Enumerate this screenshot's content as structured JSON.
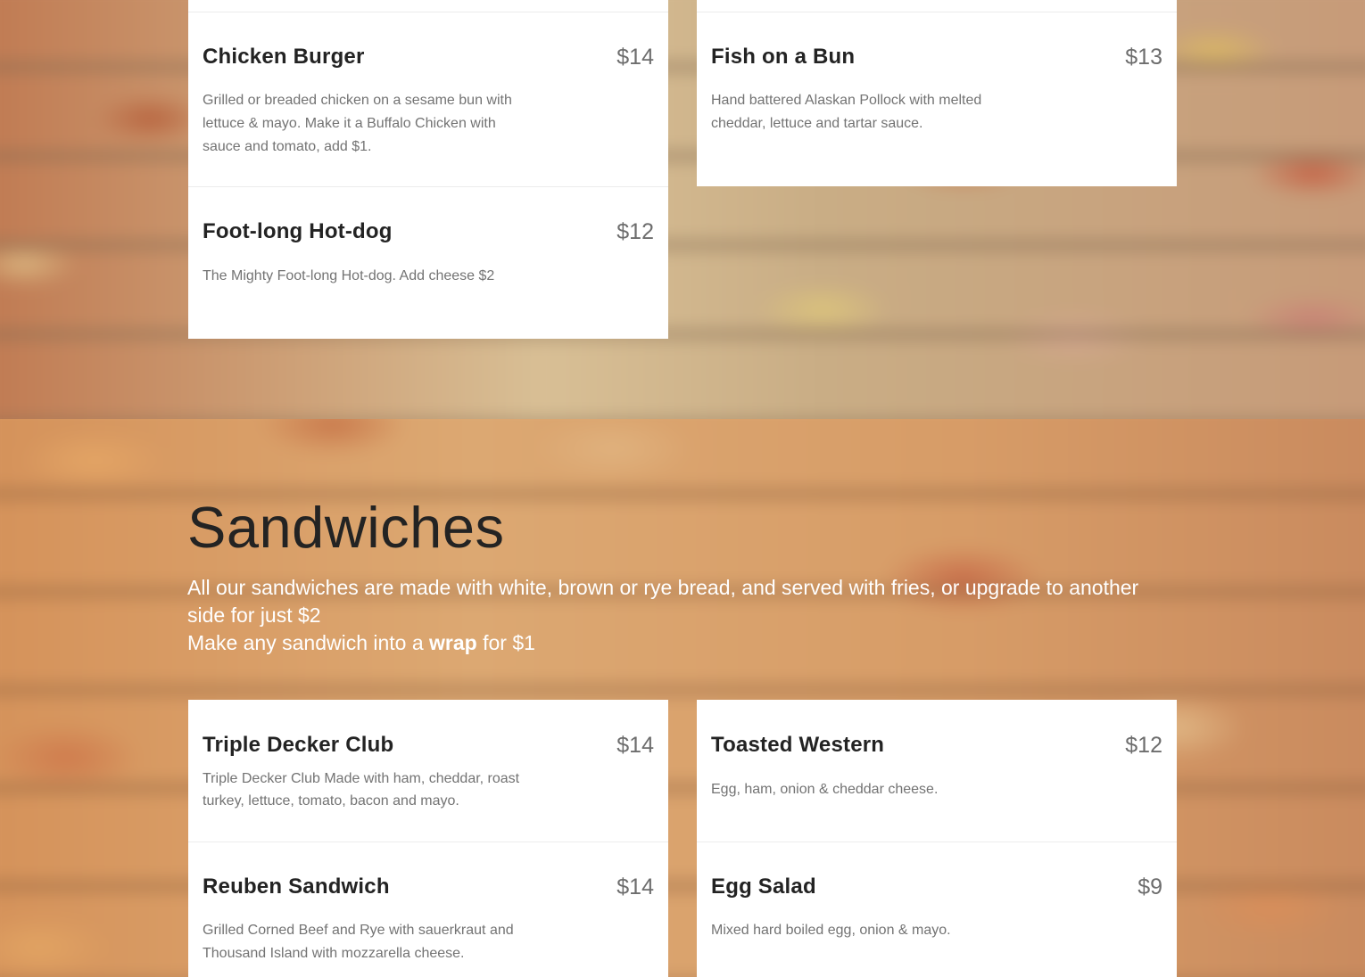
{
  "previous_section": {
    "items": [
      {
        "name": "Chicken Burger",
        "price": "$14",
        "description": "Grilled or breaded chicken on a sesame bun with lettuce & mayo. Make it a Buffalo Chicken with sauce and tomato, add $1."
      },
      {
        "name": "Fish on a Bun",
        "price": "$13",
        "description": "Hand battered Alaskan Pollock with melted cheddar, lettuce and tartar sauce."
      },
      {
        "name": "Foot-long Hot-dog",
        "price": "$12",
        "description": "The Mighty Foot-long Hot-dog. Add cheese $2"
      }
    ]
  },
  "sandwiches": {
    "title": "Sandwiches",
    "subtitle_line1": "All our sandwiches are made with white, brown or rye bread, and served with fries, or upgrade to another side for just $2",
    "subtitle_line2_before": "Make any sandwich into a ",
    "subtitle_line2_bold": "wrap",
    "subtitle_line2_after": " for $1",
    "items": [
      {
        "name": "Triple Decker Club",
        "price": "$14",
        "description": "Triple Decker Club Made with ham, cheddar, roast turkey, lettuce, tomato, bacon and mayo."
      },
      {
        "name": "Toasted Western",
        "price": "$12",
        "description": "Egg, ham, onion & cheddar cheese."
      },
      {
        "name": "Reuben Sandwich",
        "price": "$14",
        "description": "Grilled Corned Beef and Rye with sauerkraut and Thousand Island with mozzarella cheese."
      },
      {
        "name": "Egg Salad",
        "price": "$9",
        "description": "Mixed hard boiled egg, onion & mayo."
      }
    ]
  }
}
